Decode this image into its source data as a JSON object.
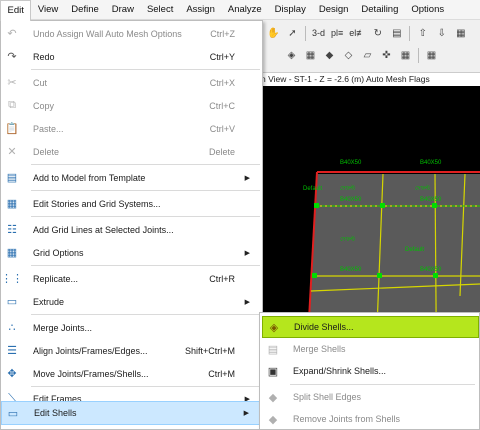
{
  "menubar": [
    "Edit",
    "View",
    "Define",
    "Draw",
    "Select",
    "Assign",
    "Analyze",
    "Display",
    "Design",
    "Detailing",
    "Options"
  ],
  "toolbar": {
    "view3d": "3-d",
    "plan": "pl≡",
    "elev": "el≢"
  },
  "view_title": "n View - ST-1 - Z = -2.6 (m)  Auto Mesh Flags",
  "canvas": {
    "label_b40x50": "B40X50",
    "label_default": "Default",
    "label_default_bn": "দেফল্ট"
  },
  "edit_menu": {
    "undo": {
      "label": "Undo Assign Wall Auto Mesh Options",
      "shortcut": "Ctrl+Z"
    },
    "redo": {
      "label": "Redo",
      "shortcut": "Ctrl+Y"
    },
    "cut": {
      "label": "Cut",
      "shortcut": "Ctrl+X"
    },
    "copy": {
      "label": "Copy",
      "shortcut": "Ctrl+C"
    },
    "paste": {
      "label": "Paste...",
      "shortcut": "Ctrl+V"
    },
    "delete": {
      "label": "Delete",
      "shortcut": "Delete"
    },
    "add_template": {
      "label": "Add to Model from Template"
    },
    "edit_stories": {
      "label": "Edit Stories and Grid Systems..."
    },
    "add_grid_lines": {
      "label": "Add Grid Lines at Selected Joints..."
    },
    "grid_options": {
      "label": "Grid Options"
    },
    "replicate": {
      "label": "Replicate...",
      "shortcut": "Ctrl+R"
    },
    "extrude": {
      "label": "Extrude"
    },
    "merge_joints": {
      "label": "Merge Joints..."
    },
    "align": {
      "label": "Align Joints/Frames/Edges...",
      "shortcut": "Shift+Ctrl+M"
    },
    "move": {
      "label": "Move Joints/Frames/Shells...",
      "shortcut": "Ctrl+M"
    },
    "edit_frames": {
      "label": "Edit Frames"
    },
    "edit_shells": {
      "label": "Edit Shells"
    }
  },
  "shells_submenu": {
    "divide": "Divide Shells...",
    "merge": "Merge Shells",
    "expand": "Expand/Shrink Shells...",
    "split_edges": "Split Shell Edges",
    "remove_joints": "Remove Joints from Shells"
  },
  "colors": {
    "highlight": "#cce8ff",
    "submenu_highlight": "#b5e61d",
    "canvas": "#000000",
    "beam": "#00c000",
    "shell": "#5a5a5a"
  }
}
